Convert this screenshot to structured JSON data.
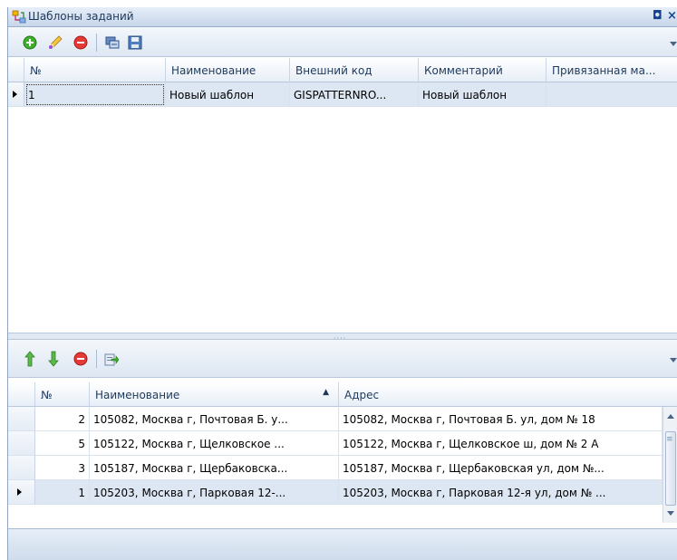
{
  "window": {
    "title": "Шаблоны заданий",
    "buttons": {
      "restore": "◘",
      "close": "×"
    }
  },
  "top_toolbar": {
    "buttons": [
      "add-icon",
      "edit-icon",
      "delete-icon",
      "link-icon",
      "save-icon"
    ]
  },
  "top_grid": {
    "columns": [
      "№",
      "Наименование",
      "Внешний код",
      "Комментарий",
      "Привязанная ма..."
    ],
    "rows": [
      {
        "num": "1",
        "name": "Новый шаблон",
        "code": "GISPATTERNRO...",
        "comment": "Новый шаблон",
        "linked": ""
      }
    ]
  },
  "bottom_toolbar": {
    "buttons": [
      "move-up-icon",
      "move-down-icon",
      "delete-icon",
      "export-icon"
    ]
  },
  "bottom_grid": {
    "columns": [
      "№",
      "Наименование",
      "Адрес"
    ],
    "sort_indicator": "▲",
    "rows": [
      {
        "num": "2",
        "name": "105082, Москва г, Почтовая Б. у...",
        "address": "105082, Москва г, Почтовая Б. ул, дом № 18"
      },
      {
        "num": "5",
        "name": "105122, Москва г, Щелковское ...",
        "address": "105122, Москва г, Щелковское ш, дом № 2 А"
      },
      {
        "num": "3",
        "name": "105187, Москва г, Щербаковска...",
        "address": "105187, Москва г, Щербаковская ул, дом №..."
      },
      {
        "num": "1",
        "name": "105203, Москва г, Парковая 12-...",
        "address": "105203, Москва г, Парковая 12-я ул, дом № ..."
      }
    ]
  },
  "colors": {
    "accent": "#1e395b",
    "selected_row": "#dde7f3",
    "add_green": "#3fae2a",
    "delete_red": "#e53935"
  }
}
